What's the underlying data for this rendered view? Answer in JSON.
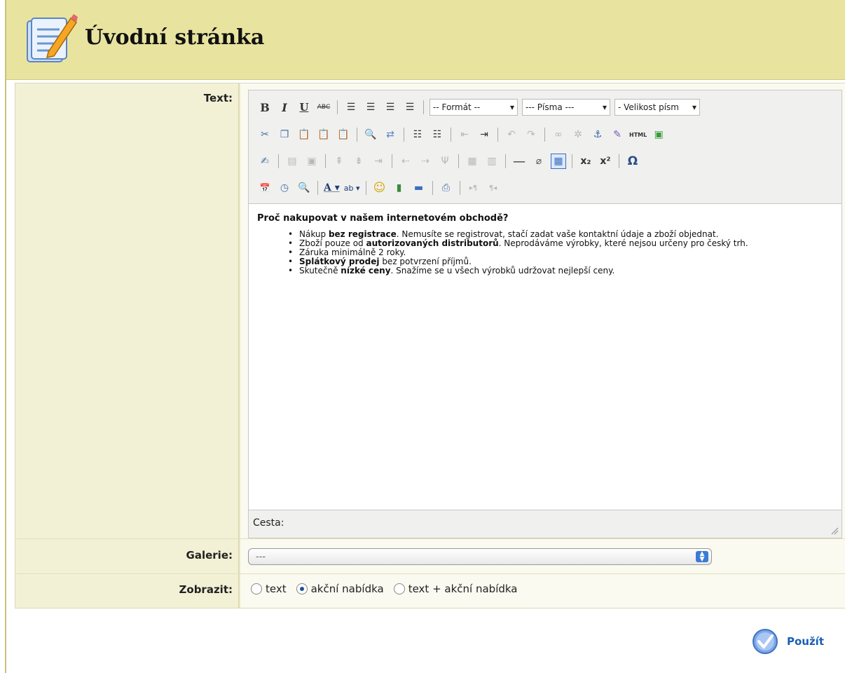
{
  "header": {
    "title": "Úvodní stránka"
  },
  "form": {
    "text_label": "Text:",
    "gallery_label": "Galerie:",
    "display_label": "Zobrazit:"
  },
  "editor": {
    "toolbar": {
      "format_select": "-- Formát --",
      "fonts_select": "--- Písma ---",
      "size_select": "- Velikost písm",
      "html_button": "HTML"
    },
    "content": {
      "heading": "Proč nakupovat v našem internetovém obchodě?",
      "items": [
        {
          "pre": "Nákup ",
          "bold": "bez registrace",
          "post": ". Nemusíte se registrovat, stačí zadat vaše kontaktní údaje a zboží objednat."
        },
        {
          "pre": "Zboží pouze od ",
          "bold": "autorizovaných distributorů",
          "post": ". Neprodáváme výrobky, které nejsou určeny pro český trh."
        },
        {
          "pre": "Záruka minimálně 2 roky.",
          "bold": "",
          "post": ""
        },
        {
          "pre": "",
          "bold": "Splátkový prodej",
          "post": " bez potvrzení příjmů."
        },
        {
          "pre": "Skutečně ",
          "bold": "nízké ceny",
          "post": ". Snažíme se u všech výrobků udržovat nejlepší ceny."
        }
      ]
    },
    "path_label": "Cesta:"
  },
  "gallery": {
    "selected": "---"
  },
  "display": {
    "options": [
      "text",
      "akční nabídka",
      "text + akční nabídka"
    ],
    "selected_index": 1
  },
  "apply_label": "Použít",
  "colors": {
    "header_bg": "#e8e4a0",
    "accent": "#1a5fb4"
  }
}
